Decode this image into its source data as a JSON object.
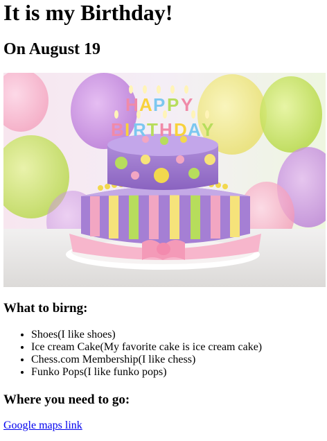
{
  "page": {
    "title": "It is my Birthday!",
    "subtitle": "On August 19"
  },
  "hero_image": {
    "subject": "birthday-cake-photo",
    "candle_text": "HAPPY BIRTHDAY"
  },
  "bring": {
    "heading": "What to birng:",
    "items": [
      "Shoes(I like shoes)",
      "Ice cream Cake(My favorite cake is ice cream cake)",
      "Chess.com Membership(I like chess)",
      "Funko Pops(I like funko pops)"
    ]
  },
  "location": {
    "heading": "Where you need to go:",
    "link_label": "Google maps link"
  }
}
